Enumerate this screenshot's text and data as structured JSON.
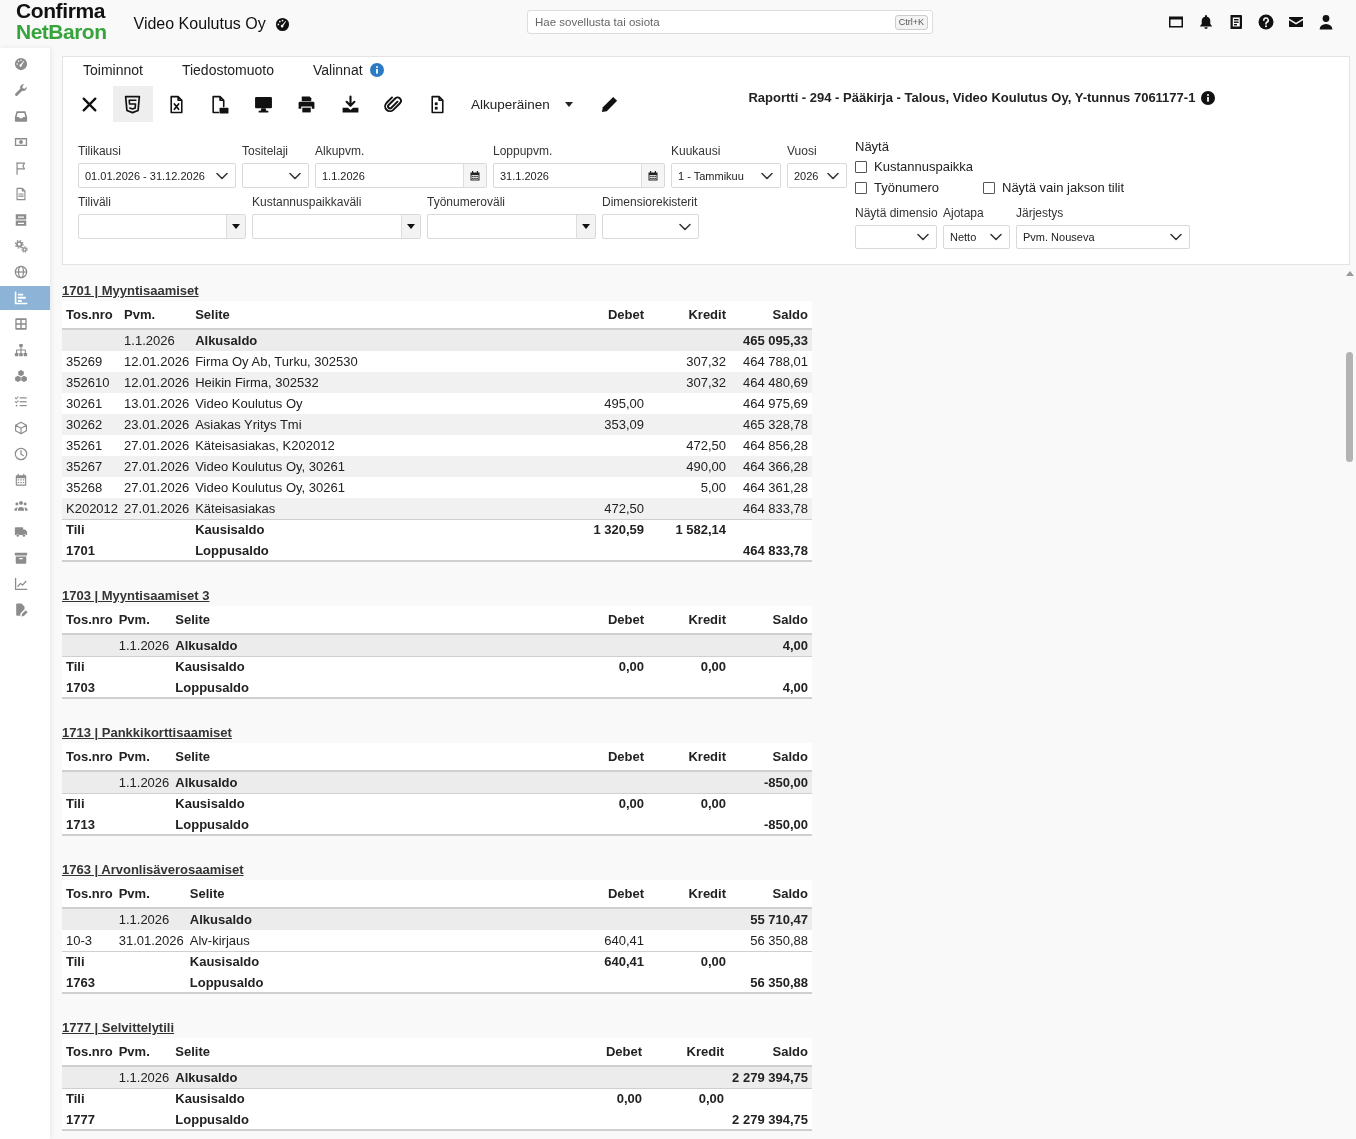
{
  "header": {
    "logo": {
      "brand": "Confirma",
      "product": "NetBaron"
    },
    "company": "Video Koulutus Oy",
    "search": {
      "placeholder": "Hae sovellusta tai osiota",
      "shortcut": "Ctrl+K"
    }
  },
  "sidebar": {
    "items": [
      {
        "selected": false
      },
      {
        "selected": false
      },
      {
        "selected": false
      },
      {
        "selected": false
      },
      {
        "selected": false
      },
      {
        "selected": false
      },
      {
        "selected": false
      },
      {
        "selected": false
      },
      {
        "selected": false
      },
      {
        "selected": true
      },
      {
        "selected": false
      },
      {
        "selected": false
      },
      {
        "selected": false
      },
      {
        "selected": false
      },
      {
        "selected": false
      },
      {
        "selected": false
      },
      {
        "selected": false
      },
      {
        "selected": false
      },
      {
        "selected": false
      },
      {
        "selected": false
      },
      {
        "selected": false
      },
      {
        "selected": false
      }
    ]
  },
  "menus": [
    {
      "label": "Toiminnot",
      "info": false
    },
    {
      "label": "Tiedostomuoto",
      "info": false
    },
    {
      "label": "Valinnat",
      "info": true
    }
  ],
  "toolbar": {
    "buttons": [
      {
        "kind": "close",
        "selected": false
      },
      {
        "kind": "html",
        "selected": true
      },
      {
        "kind": "excel",
        "selected": false
      },
      {
        "kind": "pdf",
        "selected": false
      },
      {
        "kind": "screen",
        "selected": false
      },
      {
        "kind": "print",
        "selected": false
      },
      {
        "kind": "download",
        "selected": false
      },
      {
        "kind": "attachment",
        "selected": false
      },
      {
        "kind": "document",
        "selected": false
      }
    ],
    "layout": "Alkuperäinen"
  },
  "report_title": "Raportti - 294 - Pääkirja - Talous, Video Koulutus Oy, Y-tunnus 7061177-1",
  "filters": {
    "row_1": [
      {
        "label": "Tilikausi",
        "kind": "select",
        "value": "01.01.2026 - 31.12.2026"
      },
      {
        "label": "Tositelaji",
        "kind": "select"
      },
      {
        "label": "Alkupvm.",
        "kind": "date",
        "value": "1.1.2026"
      },
      {
        "label": "Loppupvm.",
        "kind": "date",
        "value": "31.1.2026"
      },
      {
        "label": "Kuukausi",
        "kind": "select",
        "value": "1 - Tammikuu"
      },
      {
        "label": "Vuosi",
        "kind": "select",
        "value": "2026"
      }
    ],
    "row_2": [
      {
        "label": "Tiliväli",
        "kind": "combo"
      },
      {
        "label": "Kustannuspaikkaväli",
        "kind": "combo"
      },
      {
        "label": "Työnumeroväli",
        "kind": "combo"
      },
      {
        "label": "Dimensiorekisterit",
        "kind": "select"
      }
    ]
  },
  "display_options": {
    "heading": "Näytä",
    "checkboxes": [
      {
        "label": "Kustannuspaikka",
        "checked": false
      },
      {
        "label": "Työnumero",
        "checked": false
      },
      {
        "label": "Näytä vain jakson tilit",
        "checked": false
      }
    ],
    "selects": [
      {
        "label": "Näytä dimensio",
        "kind": "select"
      },
      {
        "label": "Ajotapa",
        "kind": "select",
        "value": "Netto"
      },
      {
        "label": "Järjestys",
        "kind": "select",
        "value": "Pvm. Nouseva"
      }
    ]
  },
  "accounts": [
    {
      "title": "1701 | Myyntisaamiset",
      "columns": [
        "Tos.nro",
        "Pvm.",
        "Selite",
        "Debet",
        "Kredit",
        "Saldo"
      ],
      "rows": [
        {
          "kind": "opening",
          "date": "1.1.2026",
          "description": "Alkusaldo",
          "balance": "465 095,33"
        },
        {
          "kind": "entry",
          "doc": "35269",
          "date": "12.01.2026",
          "description": "Firma Oy Ab, Turku, 302530",
          "credit": "307,32",
          "balance": "464 788,01"
        },
        {
          "kind": "entry",
          "doc": "352610",
          "date": "12.01.2026",
          "description": "Heikin Firma, 302532",
          "credit": "307,32",
          "balance": "464 480,69"
        },
        {
          "kind": "entry",
          "doc": "30261",
          "date": "13.01.2026",
          "description": "Video Koulutus Oy",
          "debit": "495,00",
          "balance": "464 975,69"
        },
        {
          "kind": "entry",
          "doc": "30262",
          "date": "23.01.2026",
          "description": "Asiakas Yritys Tmi",
          "debit": "353,09",
          "balance": "465 328,78"
        },
        {
          "kind": "entry",
          "doc": "35261",
          "date": "27.01.2026",
          "description": "Käteisasiakas, K202012",
          "credit": "472,50",
          "balance": "464 856,28"
        },
        {
          "kind": "entry",
          "doc": "35267",
          "date": "27.01.2026",
          "description": "Video Koulutus Oy, 30261",
          "credit": "490,00",
          "balance": "464 366,28"
        },
        {
          "kind": "entry",
          "doc": "35268",
          "date": "27.01.2026",
          "description": "Video Koulutus Oy, 30261",
          "credit": "5,00",
          "balance": "464 361,28"
        },
        {
          "kind": "entry",
          "doc": "K202012",
          "date": "27.01.2026",
          "description": "Käteisasiakas",
          "debit": "472,50",
          "balance": "464 833,78"
        },
        {
          "kind": "period",
          "doc": "Tili",
          "description": "Kausisaldo",
          "debit": "1 320,59",
          "credit": "1 582,14"
        },
        {
          "kind": "closing",
          "doc": "1701",
          "description": "Loppusaldo",
          "balance": "464 833,78"
        }
      ]
    },
    {
      "title": "1703 | Myyntisaamiset 3",
      "columns": [
        "Tos.nro",
        "Pvm.",
        "Selite",
        "Debet",
        "Kredit",
        "Saldo"
      ],
      "rows": [
        {
          "kind": "opening",
          "date": "1.1.2026",
          "description": "Alkusaldo",
          "balance": "4,00"
        },
        {
          "kind": "period",
          "doc": "Tili",
          "description": "Kausisaldo",
          "debit": "0,00",
          "credit": "0,00"
        },
        {
          "kind": "closing",
          "doc": "1703",
          "description": "Loppusaldo",
          "balance": "4,00"
        }
      ]
    },
    {
      "title": "1713 | Pankkikorttisaamiset",
      "columns": [
        "Tos.nro",
        "Pvm.",
        "Selite",
        "Debet",
        "Kredit",
        "Saldo"
      ],
      "rows": [
        {
          "kind": "opening",
          "date": "1.1.2026",
          "description": "Alkusaldo",
          "balance": "-850,00"
        },
        {
          "kind": "period",
          "doc": "Tili",
          "description": "Kausisaldo",
          "debit": "0,00",
          "credit": "0,00"
        },
        {
          "kind": "closing",
          "doc": "1713",
          "description": "Loppusaldo",
          "balance": "-850,00"
        }
      ]
    },
    {
      "title": "1763 | Arvonlisäverosaamiset",
      "columns": [
        "Tos.nro",
        "Pvm.",
        "Selite",
        "Debet",
        "Kredit",
        "Saldo"
      ],
      "rows": [
        {
          "kind": "opening",
          "date": "1.1.2026",
          "description": "Alkusaldo",
          "balance": "55 710,47"
        },
        {
          "kind": "entry",
          "doc": "10-3",
          "date": "31.01.2026",
          "description": "Alv-kirjaus",
          "debit": "640,41",
          "balance": "56 350,88"
        },
        {
          "kind": "period",
          "doc": "Tili",
          "description": "Kausisaldo",
          "debit": "640,41",
          "credit": "0,00"
        },
        {
          "kind": "closing",
          "doc": "1763",
          "description": "Loppusaldo",
          "balance": "56 350,88"
        }
      ]
    },
    {
      "title": "1777 | Selvittelytili",
      "columns": [
        "Tos.nro",
        "Pvm.",
        "Selite",
        "Debet",
        "Kredit",
        "Saldo"
      ],
      "rows": [
        {
          "kind": "opening",
          "date": "1.1.2026",
          "description": "Alkusaldo",
          "balance": "2 279 394,75"
        },
        {
          "kind": "period",
          "doc": "Tili",
          "description": "Kausisaldo",
          "debit": "0,00",
          "credit": "0,00"
        },
        {
          "kind": "closing",
          "doc": "1777",
          "description": "Loppusaldo",
          "balance": "2 279 394,75"
        }
      ]
    }
  ]
}
